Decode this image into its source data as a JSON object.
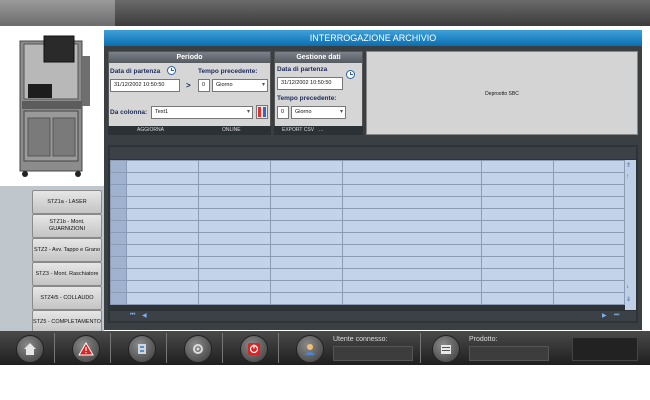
{
  "header": {
    "title": "INTERROGAZIONE ARCHIVIO"
  },
  "stations": [
    {
      "label": "STZ1a - LASER"
    },
    {
      "label": "STZ1b - Mont. GUARNIZIONI"
    },
    {
      "label": "STZ2 - Avv. Tappo e Grano"
    },
    {
      "label": "STZ3 - Mont. Raschiatore"
    },
    {
      "label": "STZ4/5 - COLLAUDO"
    },
    {
      "label": "STZ5 - COMPLETAMENTO"
    }
  ],
  "periodo": {
    "title": "Periodo",
    "start_label": "Data di partenza",
    "start_value": "31/12/2002 10:50:50",
    "arrow": ">",
    "prev_label": "Tempo precedente:",
    "prev_value": "0",
    "prev_unit": "Giorno",
    "column_label": "Da colonna:",
    "column_value": "Text1",
    "update_button": "AGGIORNA",
    "online_button": "ONLINE"
  },
  "gestione": {
    "title": "Gestione dati",
    "start_label": "Data di partenza",
    "start_value": "31/12/2002 10:50:50",
    "prev_label": "Tempo precedente:",
    "prev_value": "0",
    "prev_unit": "Giorno",
    "export_button": "EXPORT CSV",
    "more_button": "..."
  },
  "placeholder_panel": {
    "text": "Deprootto SBC"
  },
  "grid": {
    "rows": 12,
    "cols": 7
  },
  "footer": {
    "user_label": "Utente connesso:",
    "user_value": "",
    "product_label": "Prodotto:",
    "product_value": ""
  },
  "icons": [
    "home-icon",
    "alarm-icon",
    "settings-icon",
    "tools-icon",
    "power-icon",
    "user-icon",
    "report-icon"
  ]
}
